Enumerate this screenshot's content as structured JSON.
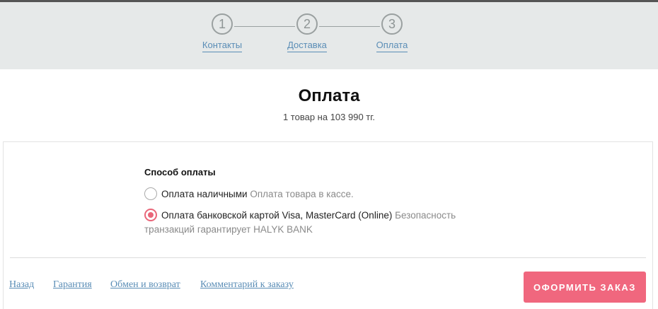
{
  "stepper": {
    "steps": [
      {
        "number": "1",
        "label": "Контакты"
      },
      {
        "number": "2",
        "label": "Доставка"
      },
      {
        "number": "3",
        "label": "Оплата"
      }
    ]
  },
  "header": {
    "title": "Оплата",
    "summary": "1 товар на 103 990 тг."
  },
  "payment": {
    "heading": "Способ оплаты",
    "options": [
      {
        "label": "Оплата наличными",
        "description": "Оплата товара в кассе.",
        "selected": false
      },
      {
        "label": "Оплата банковской картой Visa, MasterCard (Online)",
        "description": "Безопасность транзакций гарантирует HALYK BANK",
        "selected": true
      }
    ]
  },
  "footer": {
    "links": {
      "back": "Назад",
      "warranty": "Гарантия",
      "exchange": "Обмен и возврат",
      "comment": "Комментарий к заказу"
    },
    "submit_label": "ОФОРМИТЬ ЗАКАЗ"
  },
  "colors": {
    "accent": "#f0677e",
    "link": "#5a8db6",
    "stepper_bg": "#e6e9e9"
  }
}
